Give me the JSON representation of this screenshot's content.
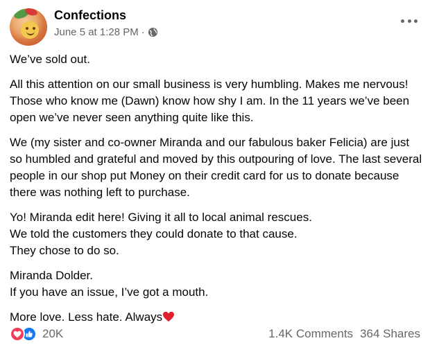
{
  "post": {
    "page_name": "Confections",
    "date": "June 5 at 1:28 PM",
    "separator": "·",
    "privacy_icon": "globe-icon",
    "more_icon": "more-options-icon",
    "paragraphs": [
      "We’ve sold out.",
      "All this attention on our small business is very humbling. Makes me nervous! Those who know me (Dawn) know how shy I am. In the 11 years we’ve been open we’ve never seen anything quite like this.",
      "We (my sister and co-owner Miranda and our fabulous baker Felicia) are  just so humbled and grateful and moved by this outpouring of love. The last several people in our shop put Money on their credit card for us to donate because there was nothing left to purchase.",
      "Yo! Miranda edit here! Giving it all to local animal rescues.\nWe told the customers they could donate to that cause.\nThey chose to do so.",
      "Miranda Dolder.\nIf you have an issue, I’ve got a mouth."
    ],
    "closing_text": "More love. Less hate. Always",
    "closing_emoji": "red-heart-icon"
  },
  "footer": {
    "reaction_icons": [
      "love-reaction-icon",
      "like-reaction-icon"
    ],
    "reaction_count": "20K",
    "comments": "1.4K Comments",
    "shares": "364 Shares"
  },
  "colors": {
    "secondary_text": "#65676b",
    "love": "#f33e58",
    "like": "#1877f2"
  }
}
